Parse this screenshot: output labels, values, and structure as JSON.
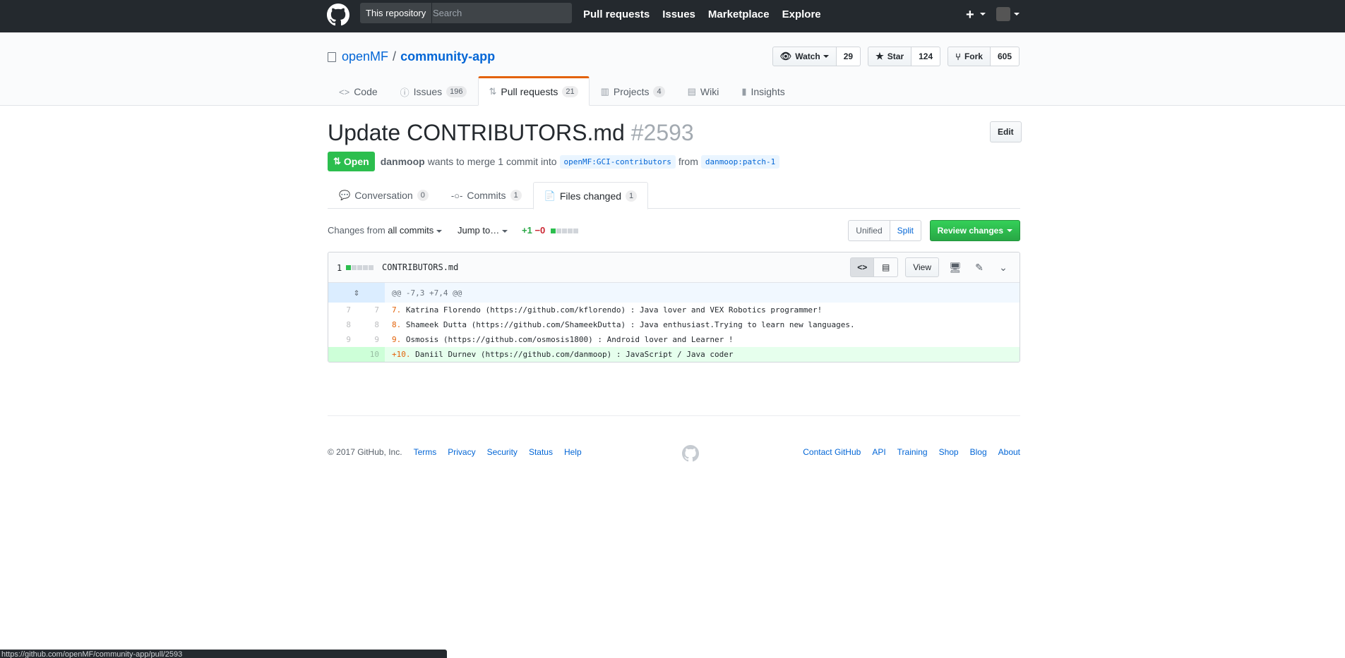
{
  "header": {
    "search_scope": "This repository",
    "search_placeholder": "Search",
    "nav": [
      "Pull requests",
      "Issues",
      "Marketplace",
      "Explore"
    ],
    "plus": "+"
  },
  "repo": {
    "owner": "openMF",
    "separator": "/",
    "name": "community-app",
    "watch_label": "Watch",
    "watch_count": "29",
    "star_label": "Star",
    "star_count": "124",
    "fork_label": "Fork",
    "fork_count": "605",
    "tabs": [
      {
        "label": "Code",
        "icon": "code-icon",
        "count": ""
      },
      {
        "label": "Issues",
        "icon": "issue-icon",
        "count": "196"
      },
      {
        "label": "Pull requests",
        "icon": "pull-request-icon",
        "count": "21"
      },
      {
        "label": "Projects",
        "icon": "project-icon",
        "count": "4"
      },
      {
        "label": "Wiki",
        "icon": "book-icon",
        "count": ""
      },
      {
        "label": "Insights",
        "icon": "graph-icon",
        "count": ""
      }
    ]
  },
  "pr": {
    "title": "Update CONTRIBUTORS.md",
    "number": "#2593",
    "edit_label": "Edit",
    "state": "Open",
    "author": "danmoop",
    "merge_text": "wants to merge 1 commit into",
    "base": "openMF:GCI-contributors",
    "from_text": "from",
    "head": "danmoop:patch-1",
    "tabs": [
      {
        "label": "Conversation",
        "count": "0"
      },
      {
        "label": "Commits",
        "count": "1"
      },
      {
        "label": "Files changed",
        "count": "1"
      }
    ]
  },
  "toolbar": {
    "changes_from": "Changes from",
    "all_commits": "all commits",
    "jump_to": "Jump to…",
    "additions": "+1",
    "deletions": "−0",
    "unified": "Unified",
    "split": "Split",
    "review": "Review changes"
  },
  "file": {
    "change_count": "1",
    "name": "CONTRIBUTORS.md",
    "view_label": "View",
    "hunk": "@@ -7,3 +7,4 @@",
    "lines": [
      {
        "old": "7",
        "new": "7",
        "num": "7.",
        "text": " Katrina Florendo (https://github.com/kflorendo) : Java lover and VEX Robotics programmer!",
        "type": "context"
      },
      {
        "old": "8",
        "new": "8",
        "num": "8.",
        "text": " Shameek Dutta (https://github.com/ShameekDutta) : Java enthusiast.Trying to learn new languages.",
        "type": "context"
      },
      {
        "old": "9",
        "new": "9",
        "num": "9.",
        "text": " Osmosis (https://github.com/osmosis1800) : Android lover and Learner !",
        "type": "context"
      },
      {
        "old": "",
        "new": "10",
        "num": "+10.",
        "text": " Daniil Durnev (https://github.com/danmoop) : JavaScript / Java coder",
        "type": "addition"
      }
    ]
  },
  "footer": {
    "copyright": "© 2017 GitHub, Inc.",
    "left_links": [
      "Terms",
      "Privacy",
      "Security",
      "Status",
      "Help"
    ],
    "right_links": [
      "Contact GitHub",
      "API",
      "Training",
      "Shop",
      "Blog",
      "About"
    ]
  },
  "status_url": "https://github.com/openMF/community-app/pull/2593",
  "colors": {
    "header": "#24292e",
    "open": "#2cbe4e",
    "link": "#0366d6",
    "accent": "#e36209"
  }
}
